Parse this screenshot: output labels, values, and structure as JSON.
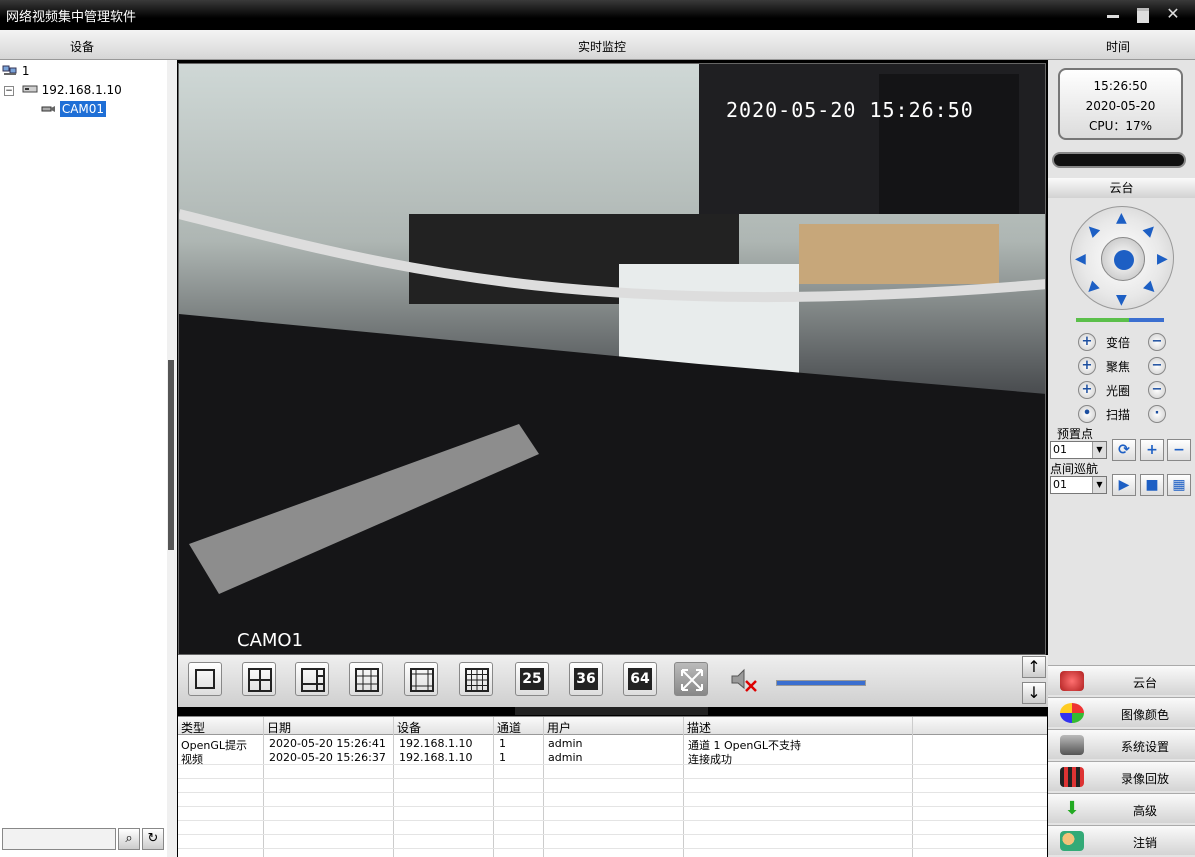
{
  "window": {
    "title": "网络视频集中管理软件"
  },
  "header": {
    "device_col": "设备",
    "live_col": "实时监控",
    "time_col": "时间"
  },
  "tree": {
    "root_label": "1",
    "device_ip": "192.168.1.10",
    "camera_label": "CAM01"
  },
  "video": {
    "timestamp": "2020-05-20 15:26:50",
    "camera_overlay": "CAMO1"
  },
  "toolbar": {
    "grid_buttons": [
      "25",
      "36",
      "64"
    ]
  },
  "log": {
    "headers": [
      "类型",
      "日期",
      "设备",
      "通道",
      "用户",
      "描述"
    ],
    "rows": [
      {
        "type": "OpenGL提示",
        "date": "2020-05-20 15:26:41",
        "device": "192.168.1.10",
        "channel": "1",
        "user": "admin",
        "desc": "通道 1 OpenGL不支持"
      },
      {
        "type": "视频",
        "date": "2020-05-20 15:26:37",
        "device": "192.168.1.10",
        "channel": "1",
        "user": "admin",
        "desc": "连接成功"
      }
    ]
  },
  "status": {
    "time": "15:26:50",
    "date": "2020-05-20",
    "cpu": "CPU：17%"
  },
  "ptz": {
    "title": "云台",
    "zoom": "变倍",
    "focus": "聚焦",
    "iris": "光圈",
    "scan": "扫描",
    "preset_label": "预置点",
    "preset_value": "01",
    "cruise_label": "点间巡航",
    "cruise_value": "01"
  },
  "menu": {
    "ptz": "云台",
    "image_color": "图像颜色",
    "system_settings": "系统设置",
    "playback": "录像回放",
    "advanced": "高级",
    "logout": "注销"
  },
  "colors": {
    "accent": "#1d5fc4",
    "selection": "#1f6fd6"
  }
}
